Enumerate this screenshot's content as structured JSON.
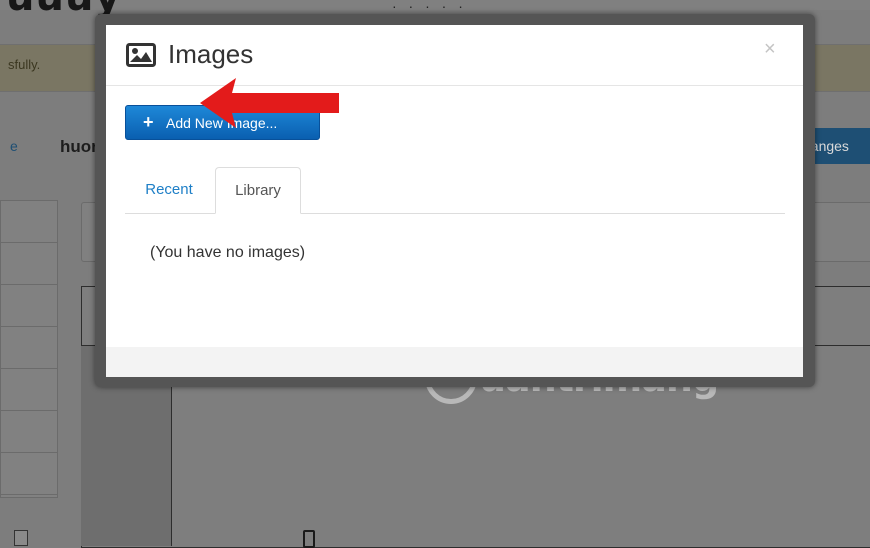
{
  "background": {
    "logo": "uuuy",
    "top_dots": "· · · · ·",
    "notice_text": "sfully.",
    "nav_link": "e",
    "username": "huor",
    "save_button": "changes"
  },
  "modal": {
    "title": "Images",
    "title_icon": "image-icon",
    "close_label": "×",
    "add_button": {
      "icon": "plus-icon",
      "label": "Add New Image..."
    },
    "tabs": [
      {
        "label": "Recent",
        "active": false
      },
      {
        "label": "Library",
        "active": true
      }
    ],
    "empty_message": "(You have no images)"
  },
  "watermark": {
    "text": "uantrimang"
  },
  "colors": {
    "accent_blue": "#0a6cc4",
    "arrow_red": "#e31b1b",
    "link_blue": "#1e7fc7"
  }
}
